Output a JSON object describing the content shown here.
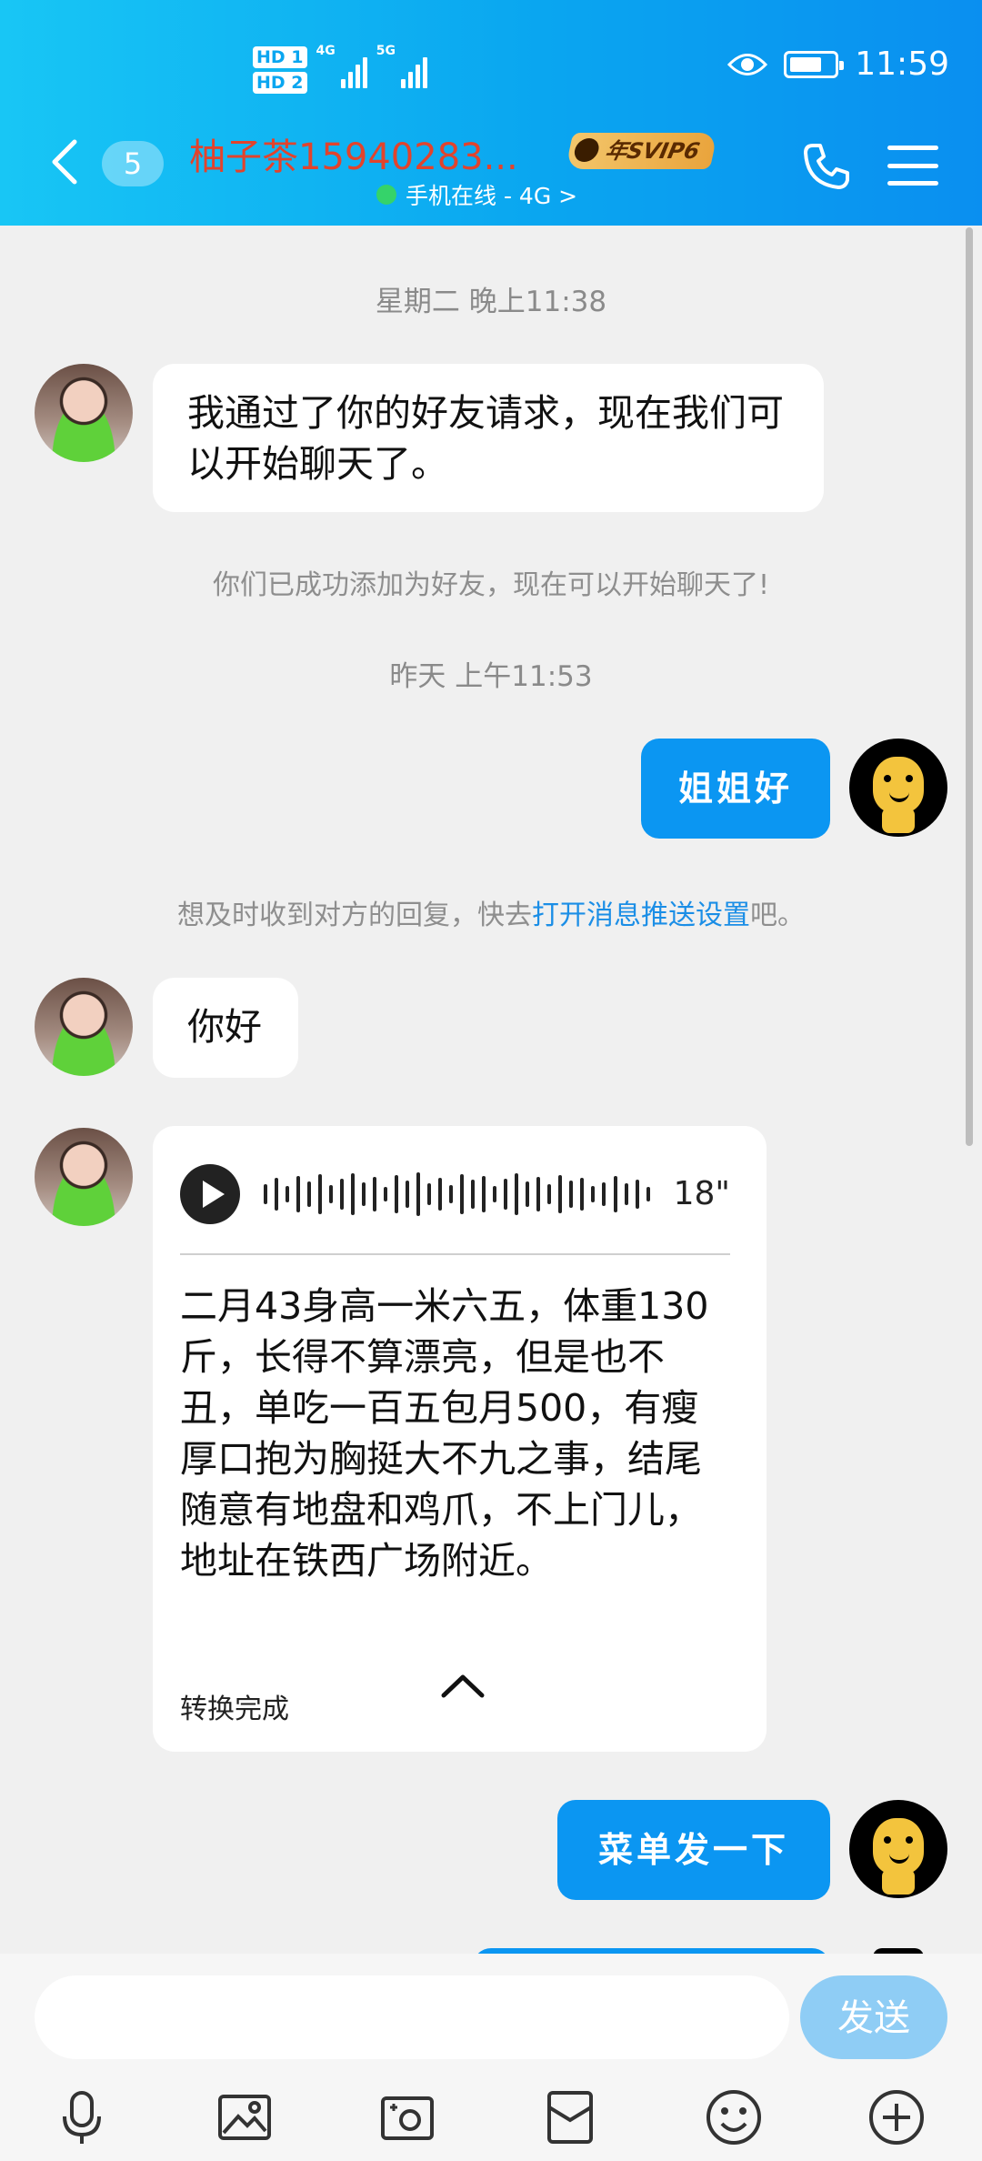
{
  "status_bar": {
    "hd1": "HD 1",
    "hd2": "HD 2",
    "net1": "4G",
    "net2": "5G",
    "time": "11:59"
  },
  "header": {
    "unread_count": "5",
    "contact_name": "柚子茶15940283...",
    "vip_badge": "年SVIP6",
    "online_status": "手机在线 - 4G >",
    "colors": {
      "gradient_start": "#18c6f5",
      "gradient_end": "#0a8ff0",
      "name_color": "#e2432c"
    }
  },
  "chat": {
    "timestamp1": "星期二 晚上11:38",
    "msg1": "我通过了你的好友请求，现在我们可以开始聊天了。",
    "system1": "你们已成功添加为好友，现在可以开始聊天了!",
    "timestamp2": "昨天 上午11:53",
    "msg2": "姐姐好",
    "system2_prefix": "想及时收到对方的回复，快去",
    "system2_link": "打开消息推送设置",
    "system2_suffix": "吧。",
    "msg3": "你好",
    "voice": {
      "duration": "18\"",
      "transcript": "二月43身高一米六五，体重130斤，长得不算漂亮，但是也不丑，单吃一百五包月500，有瘦厚口抱为胸挺大不九之事，结尾随意有地盘和鸡爪，不上门儿，地址在铁西广场附近。",
      "status": "转换完成"
    },
    "msg4": "菜单发一下"
  },
  "input_bar": {
    "placeholder": "",
    "send_label": "发送",
    "tools": [
      "microphone-icon",
      "image-icon",
      "camera-icon",
      "red-packet-icon",
      "emoji-icon",
      "plus-icon"
    ]
  }
}
